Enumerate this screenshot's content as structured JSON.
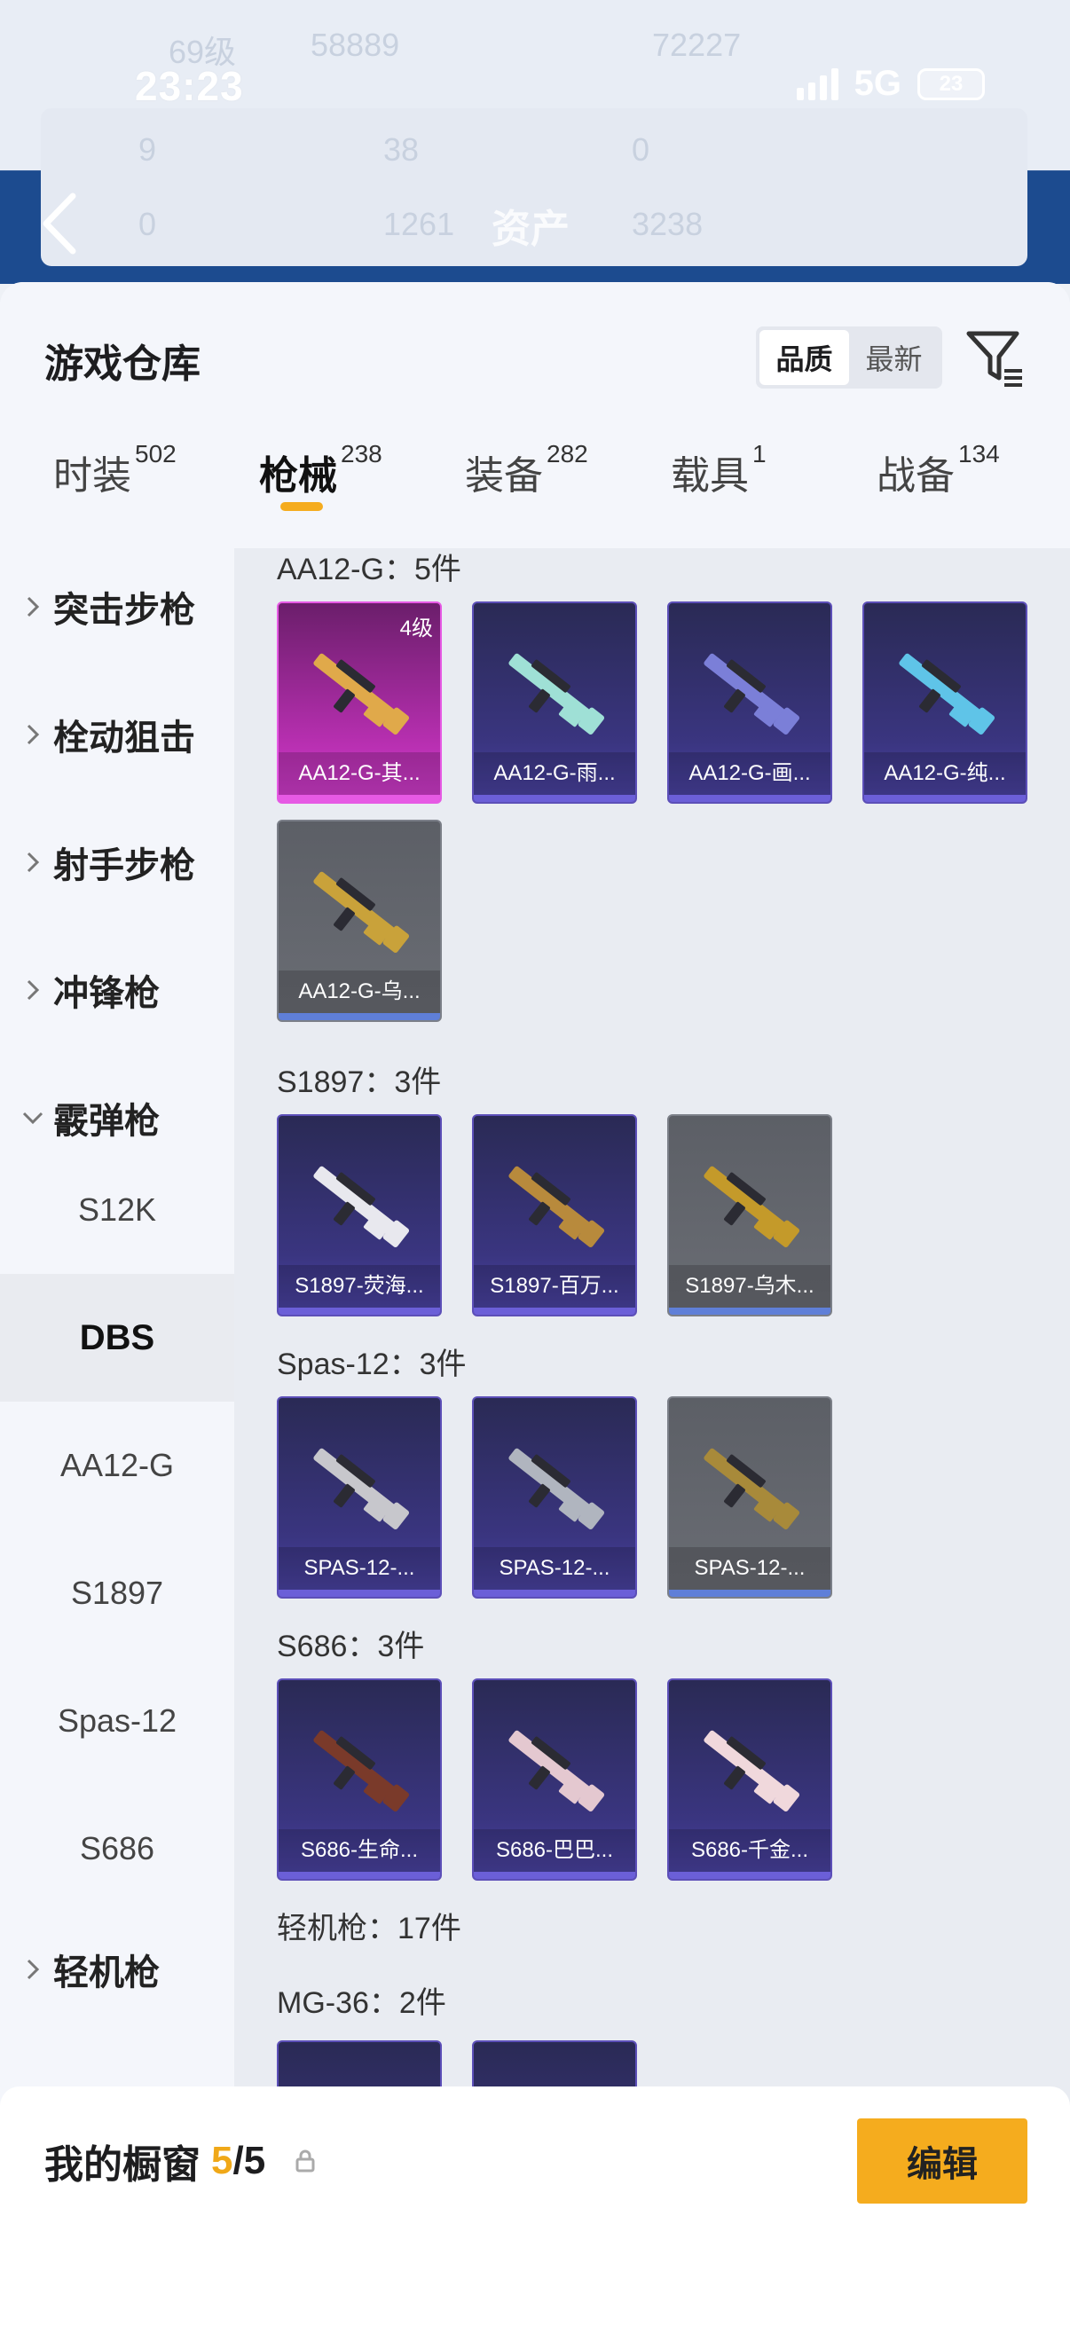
{
  "status_bar": {
    "time": "23:23",
    "network": "5G",
    "battery": "23"
  },
  "background_header": {
    "title": "资产",
    "faded_values": [
      "69级",
      "58889",
      "72227",
      "9",
      "38",
      "0",
      "0",
      "1261",
      "3238"
    ]
  },
  "sheet": {
    "title": "游戏仓库",
    "sort_options": [
      {
        "label": "品质",
        "active": true
      },
      {
        "label": "最新",
        "active": false
      }
    ]
  },
  "tabs": [
    {
      "label": "时装",
      "count": "502",
      "active": false
    },
    {
      "label": "枪械",
      "count": "238",
      "active": true
    },
    {
      "label": "装备",
      "count": "282",
      "active": false
    },
    {
      "label": "载具",
      "count": "1",
      "active": false
    },
    {
      "label": "战备",
      "count": "134",
      "active": false
    }
  ],
  "categories": [
    {
      "label": "突击步枪",
      "expanded": false
    },
    {
      "label": "栓动狙击",
      "expanded": false
    },
    {
      "label": "射手步枪",
      "expanded": false
    },
    {
      "label": "冲锋枪",
      "expanded": false
    },
    {
      "label": "霰弹枪",
      "expanded": true
    },
    {
      "label": "轻机枪",
      "expanded": false
    }
  ],
  "subcategories": [
    {
      "label": "S12K",
      "active": false
    },
    {
      "label": "DBS",
      "active": true
    },
    {
      "label": "AA12-G",
      "active": false
    },
    {
      "label": "S1897",
      "active": false
    },
    {
      "label": "Spas-12",
      "active": false
    },
    {
      "label": "S686",
      "active": false
    }
  ],
  "groups": [
    {
      "title": "AA12-G：5件",
      "items": [
        {
          "name": "AA12-G-其...",
          "rarity": "pink",
          "level": "4级"
        },
        {
          "name": "AA12-G-雨...",
          "rarity": "purple"
        },
        {
          "name": "AA12-G-画...",
          "rarity": "purple"
        },
        {
          "name": "AA12-G-纯...",
          "rarity": "purple"
        },
        {
          "name": "AA12-G-乌...",
          "rarity": "gray"
        }
      ]
    },
    {
      "title": "S1897：3件",
      "items": [
        {
          "name": "S1897-荧海...",
          "rarity": "purple"
        },
        {
          "name": "S1897-百万...",
          "rarity": "purple"
        },
        {
          "name": "S1897-乌木...",
          "rarity": "gray"
        }
      ]
    },
    {
      "title": "Spas-12：3件",
      "items": [
        {
          "name": "SPAS-12-...",
          "rarity": "purple"
        },
        {
          "name": "SPAS-12-...",
          "rarity": "purple"
        },
        {
          "name": "SPAS-12-...",
          "rarity": "gray"
        }
      ]
    },
    {
      "title": "S686：3件",
      "items": [
        {
          "name": "S686-生命...",
          "rarity": "purple"
        },
        {
          "name": "S686-巴巴...",
          "rarity": "purple"
        },
        {
          "name": "S686-千金...",
          "rarity": "purple"
        }
      ]
    }
  ],
  "section_lmg": {
    "title": "轻机枪：17件"
  },
  "group_mg36": {
    "title": "MG-36：2件"
  },
  "bottom_bar": {
    "title": "我的橱窗",
    "current": "5",
    "separator": "/",
    "total": "5",
    "edit_label": "编辑"
  },
  "colors": {
    "accent": "#f5ac1e",
    "purple_card": "#3a3580",
    "pink_card": "#b72fb0",
    "gray_card": "#62656c"
  }
}
